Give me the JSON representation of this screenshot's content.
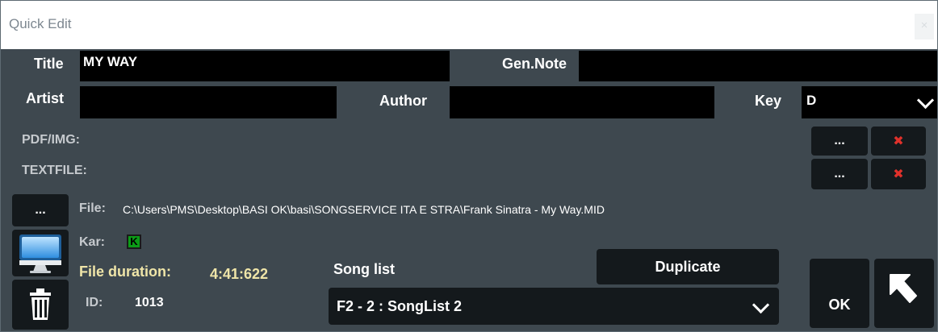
{
  "window": {
    "title": "Quick Edit",
    "close_glyph": "×"
  },
  "fields": {
    "title_label": "Title",
    "title_value": "MY WAY",
    "gen_note_label": "Gen.Note",
    "gen_note_value": "",
    "artist_label": "Artist",
    "artist_value": "",
    "author_label": "Author",
    "author_value": "",
    "key_label": "Key",
    "key_value": "D"
  },
  "attachments": {
    "pdf_label": "PDF/IMG:",
    "text_label": "TEXTFILE:",
    "browse_label": "...",
    "remove_glyph": "✖"
  },
  "file": {
    "browse_label": "...",
    "file_label": "File:",
    "file_path": "C:\\Users\\PMS\\Desktop\\BASI OK\\basi\\SONGSERVICE ITA E STRA\\Frank Sinatra - My Way.MID",
    "kar_label": "Kar:",
    "kar_badge": "K",
    "duration_label": "File duration:",
    "duration_value": "4:41:622",
    "id_label": "ID:",
    "id_value": "1013"
  },
  "songlist": {
    "label": "Song list",
    "duplicate_label": "Duplicate",
    "selected": "F2 - 2 : SongList 2"
  },
  "actions": {
    "ok_label": "OK"
  },
  "icons": [
    "monitor-icon",
    "trash-icon",
    "cursor-arrow-icon",
    "chevron-down-icon",
    "close-x-icon"
  ]
}
